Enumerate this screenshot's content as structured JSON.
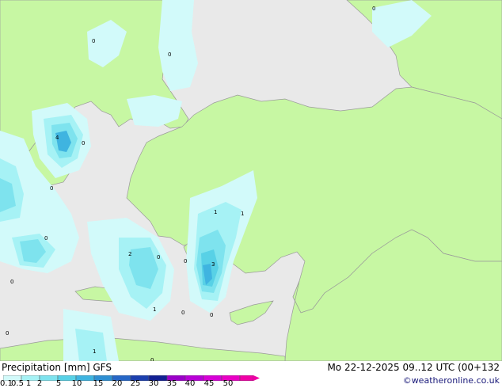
{
  "map": {
    "station_values": [
      "0",
      "0",
      "0",
      "4",
      "0",
      "0",
      "0",
      "1",
      "1",
      "2",
      "0",
      "0",
      "3",
      "1",
      "0",
      "0",
      "0",
      "0",
      "1",
      "0"
    ]
  },
  "footer": {
    "left_title": "Precipitation [mm]  GFS",
    "right_title": "Mo 22-12-2025 09..12 UTC (00+132",
    "credit": "©weatheronline.co.uk"
  },
  "legend": {
    "ticks": [
      "0.1",
      "0.5",
      "1",
      "2",
      "5",
      "10",
      "15",
      "20",
      "25",
      "30",
      "35",
      "40",
      "45",
      "50"
    ],
    "colors": [
      "#d2fafa",
      "#a6f2f5",
      "#7ee3ee",
      "#58d1e6",
      "#3fb4e0",
      "#2f8fd2",
      "#2666c6",
      "#1c3fae",
      "#122093",
      "#9a00c8",
      "#b800d6",
      "#d600d6",
      "#e800c4",
      "#f000a6"
    ]
  },
  "colors": {
    "land": "#c7f7a3",
    "sea": "#e9e9e9",
    "border": "#9a9a9a"
  }
}
